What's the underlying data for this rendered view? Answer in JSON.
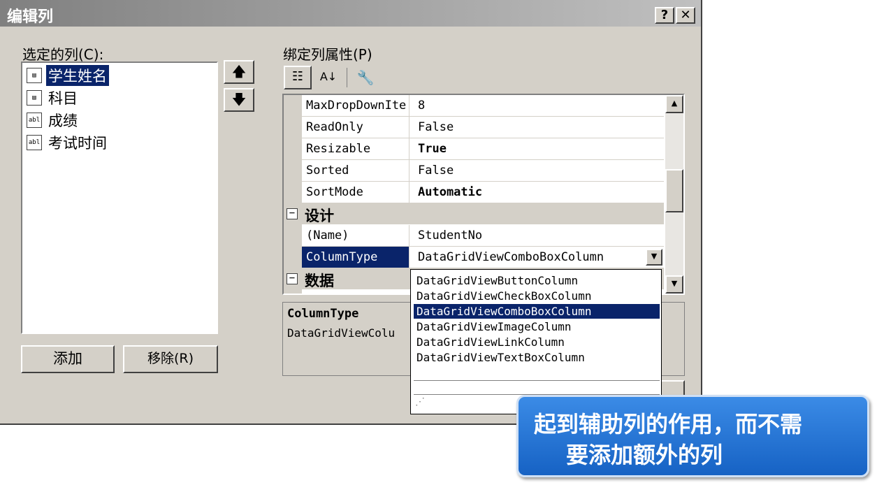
{
  "dialog": {
    "title": "编辑列",
    "help_button": "?",
    "close_button": "✕"
  },
  "selected_columns": {
    "label": "选定的列(C):",
    "items": [
      {
        "label": "学生姓名",
        "icon": "combobox-column-icon",
        "selected": true
      },
      {
        "label": "科目",
        "icon": "combobox-column-icon",
        "selected": false
      },
      {
        "label": "成绩",
        "icon": "textbox-column-icon",
        "selected": false
      },
      {
        "label": "考试时间",
        "icon": "textbox-column-icon",
        "selected": false
      }
    ],
    "move_up": "🡅",
    "move_down": "🡇",
    "add_button": "添加",
    "remove_button": "移除(R)"
  },
  "properties": {
    "label": "绑定列属性(P)",
    "rows": [
      {
        "name": "MaxDropDownIte",
        "value": "8",
        "bold": false
      },
      {
        "name": "ReadOnly",
        "value": "False",
        "bold": false
      },
      {
        "name": "Resizable",
        "value": "True",
        "bold": true
      },
      {
        "name": "Sorted",
        "value": "False",
        "bold": false
      },
      {
        "name": "SortMode",
        "value": "Automatic",
        "bold": true
      }
    ],
    "category_design": "设计",
    "name_row": {
      "name": "(Name)",
      "value": "StudentNo"
    },
    "column_type_row": {
      "name": "ColumnType",
      "value": "DataGridViewComboBoxColumn"
    },
    "category_data": "数据",
    "description_title": "ColumnType",
    "description_text": "DataGridViewColu"
  },
  "dropdown": {
    "options": [
      "DataGridViewButtonColumn",
      "DataGridViewCheckBoxColumn",
      "DataGridViewComboBoxColumn",
      "DataGridViewImageColumn",
      "DataGridViewLinkColumn",
      "DataGridViewTextBoxColumn"
    ],
    "selected_index": 2
  },
  "callout": {
    "line1": "起到辅助列的作用，而不需",
    "line2": "要添加额外的列"
  },
  "colors": {
    "selection": "#0a246a",
    "dialog_bg": "#d4d0c8",
    "callout_bg": "#1662c4"
  }
}
